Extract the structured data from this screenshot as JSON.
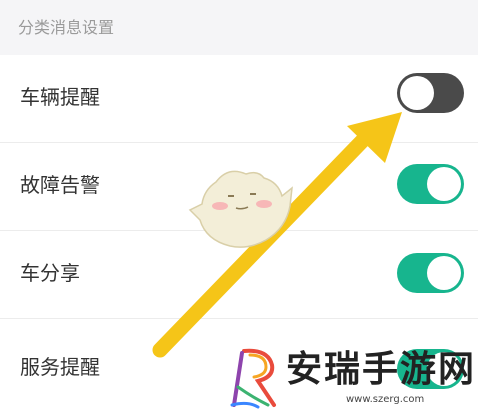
{
  "section": {
    "title": "分类消息设置"
  },
  "settings": [
    {
      "label": "车辆提醒",
      "enabled": false
    },
    {
      "label": "故障告警",
      "enabled": true
    },
    {
      "label": "车分享",
      "enabled": true
    },
    {
      "label": "服务提醒",
      "enabled": true
    }
  ],
  "colors": {
    "toggle_on": "#17b58e",
    "toggle_off": "#4a4a4a",
    "arrow": "#f5c518",
    "header_bg": "#f5f5f7"
  },
  "overlay": {
    "arrow_icon": "pointing-arrow-icon",
    "mascot_icon": "mascot-character-icon"
  },
  "watermark": {
    "text": "安瑞手游网",
    "url": "www.szerg.com"
  }
}
